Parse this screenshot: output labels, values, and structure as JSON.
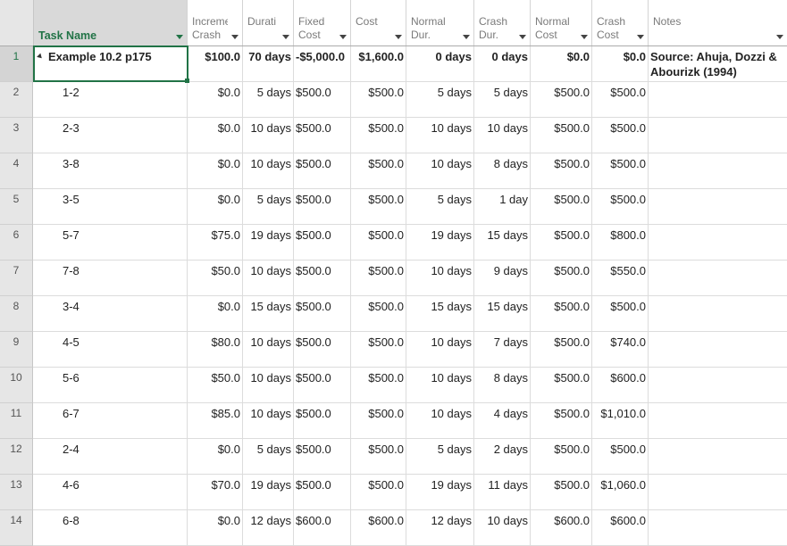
{
  "columns": [
    {
      "l1": "",
      "l2": "Task Name"
    },
    {
      "l1": "Increme",
      "l2": "Crash"
    },
    {
      "l1": "",
      "l2": "Durati"
    },
    {
      "l1": "Fixed",
      "l2": "Cost"
    },
    {
      "l1": "",
      "l2": "Cost"
    },
    {
      "l1": "Normal",
      "l2": "Dur."
    },
    {
      "l1": "Crash",
      "l2": "Dur."
    },
    {
      "l1": "Normal",
      "l2": "Cost"
    },
    {
      "l1": "Crash",
      "l2": "Cost"
    },
    {
      "l1": "",
      "l2": "Notes"
    }
  ],
  "rows": [
    {
      "num": "1",
      "name": "Example 10.2 p175",
      "inc": "$100.0",
      "dur": "70 days",
      "fixed": "-$5,000.0",
      "cost": "$1,600.0",
      "ndur": "0 days",
      "cdur": "0 days",
      "ncost": "$0.0",
      "ccost": "$0.0",
      "notes": "Source: Ahuja, Dozzi & Abourizk (1994)"
    },
    {
      "num": "2",
      "name": "1-2",
      "inc": "$0.0",
      "dur": "5 days",
      "fixed": "$500.0",
      "cost": "$500.0",
      "ndur": "5 days",
      "cdur": "5 days",
      "ncost": "$500.0",
      "ccost": "$500.0",
      "notes": ""
    },
    {
      "num": "3",
      "name": "2-3",
      "inc": "$0.0",
      "dur": "10 days",
      "fixed": "$500.0",
      "cost": "$500.0",
      "ndur": "10 days",
      "cdur": "10 days",
      "ncost": "$500.0",
      "ccost": "$500.0",
      "notes": ""
    },
    {
      "num": "4",
      "name": "3-8",
      "inc": "$0.0",
      "dur": "10 days",
      "fixed": "$500.0",
      "cost": "$500.0",
      "ndur": "10 days",
      "cdur": "8 days",
      "ncost": "$500.0",
      "ccost": "$500.0",
      "notes": ""
    },
    {
      "num": "5",
      "name": "3-5",
      "inc": "$0.0",
      "dur": "5 days",
      "fixed": "$500.0",
      "cost": "$500.0",
      "ndur": "5 days",
      "cdur": "1 day",
      "ncost": "$500.0",
      "ccost": "$500.0",
      "notes": ""
    },
    {
      "num": "6",
      "name": "5-7",
      "inc": "$75.0",
      "dur": "19 days",
      "fixed": "$500.0",
      "cost": "$500.0",
      "ndur": "19 days",
      "cdur": "15 days",
      "ncost": "$500.0",
      "ccost": "$800.0",
      "notes": ""
    },
    {
      "num": "7",
      "name": "7-8",
      "inc": "$50.0",
      "dur": "10 days",
      "fixed": "$500.0",
      "cost": "$500.0",
      "ndur": "10 days",
      "cdur": "9 days",
      "ncost": "$500.0",
      "ccost": "$550.0",
      "notes": ""
    },
    {
      "num": "8",
      "name": "3-4",
      "inc": "$0.0",
      "dur": "15 days",
      "fixed": "$500.0",
      "cost": "$500.0",
      "ndur": "15 days",
      "cdur": "15 days",
      "ncost": "$500.0",
      "ccost": "$500.0",
      "notes": ""
    },
    {
      "num": "9",
      "name": "4-5",
      "inc": "$80.0",
      "dur": "10 days",
      "fixed": "$500.0",
      "cost": "$500.0",
      "ndur": "10 days",
      "cdur": "7 days",
      "ncost": "$500.0",
      "ccost": "$740.0",
      "notes": ""
    },
    {
      "num": "10",
      "name": "5-6",
      "inc": "$50.0",
      "dur": "10 days",
      "fixed": "$500.0",
      "cost": "$500.0",
      "ndur": "10 days",
      "cdur": "8 days",
      "ncost": "$500.0",
      "ccost": "$600.0",
      "notes": ""
    },
    {
      "num": "11",
      "name": "6-7",
      "inc": "$85.0",
      "dur": "10 days",
      "fixed": "$500.0",
      "cost": "$500.0",
      "ndur": "10 days",
      "cdur": "4 days",
      "ncost": "$500.0",
      "ccost": "$1,010.0",
      "notes": ""
    },
    {
      "num": "12",
      "name": "2-4",
      "inc": "$0.0",
      "dur": "5 days",
      "fixed": "$500.0",
      "cost": "$500.0",
      "ndur": "5 days",
      "cdur": "2 days",
      "ncost": "$500.0",
      "ccost": "$500.0",
      "notes": ""
    },
    {
      "num": "13",
      "name": "4-6",
      "inc": "$70.0",
      "dur": "19 days",
      "fixed": "$500.0",
      "cost": "$500.0",
      "ndur": "19 days",
      "cdur": "11 days",
      "ncost": "$500.0",
      "ccost": "$1,060.0",
      "notes": ""
    },
    {
      "num": "14",
      "name": "6-8",
      "inc": "$0.0",
      "dur": "12 days",
      "fixed": "$600.0",
      "cost": "$600.0",
      "ndur": "12 days",
      "cdur": "10 days",
      "ncost": "$600.0",
      "ccost": "$600.0",
      "notes": ""
    }
  ],
  "colors": {
    "accent": "#217346"
  }
}
